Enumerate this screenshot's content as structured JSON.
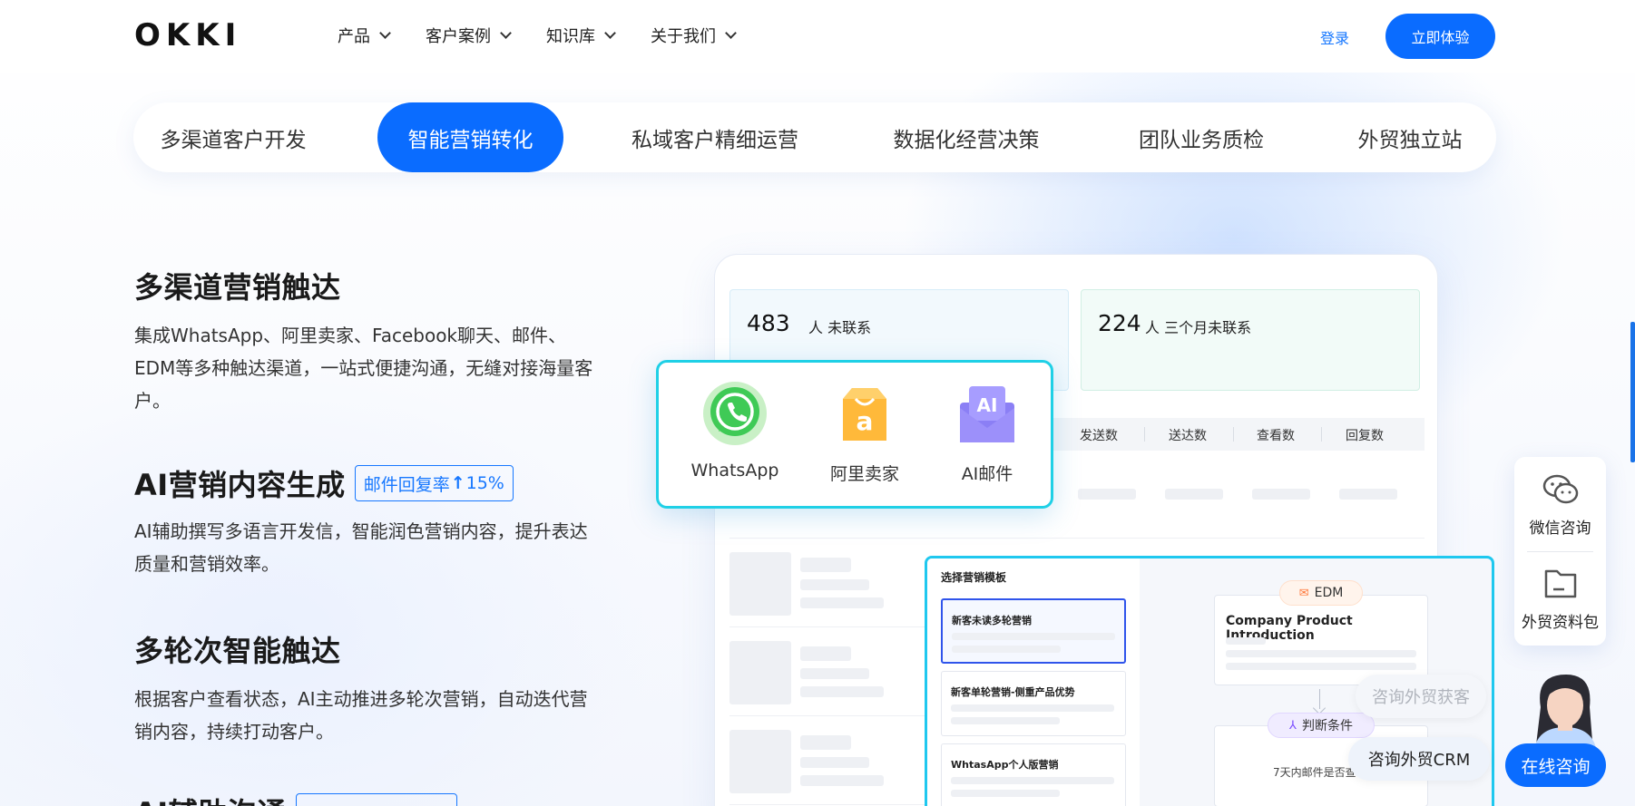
{
  "header": {
    "logo_text": "OKKI",
    "nav": [
      "产品",
      "客户案例",
      "知识库",
      "关于我们"
    ],
    "login": "登录",
    "cta": "立即体验"
  },
  "tabs": [
    {
      "label": "多渠道客户开发",
      "active": false
    },
    {
      "label": "智能营销转化",
      "active": true
    },
    {
      "label": "私域客户精细运营",
      "active": false
    },
    {
      "label": "数据化经营决策",
      "active": false
    },
    {
      "label": "团队业务质检",
      "active": false
    },
    {
      "label": "外贸独立站",
      "active": false
    }
  ],
  "features": [
    {
      "title": "多渠道营销触达",
      "desc": "集成WhatsApp、阿里卖家、Facebook聊天、邮件、EDM等多种触达渠道，一站式便捷沟通，无缝对接海量客户。"
    },
    {
      "title": "AI营销内容生成",
      "badge_text": "邮件回复率",
      "badge_value": "15%",
      "desc": "AI辅助撰写多语言开发信，智能润色营销内容，提升表达质量和营销效率。"
    },
    {
      "title": "多轮次智能触达",
      "desc": "根据客户查看状态，AI主动推进多轮次营销，自动迭代营销内容，持续打动客户。"
    },
    {
      "title": "AI辅助沟通"
    }
  ],
  "panel": {
    "stat1": {
      "num": "483",
      "label": "人 未联系"
    },
    "stat2": {
      "num": "224",
      "label": "人 三个月未联系"
    },
    "columns": [
      "发送数",
      "送达数",
      "查看数",
      "回复数"
    ]
  },
  "channels": [
    {
      "name": "WhatsApp",
      "icon": "whatsapp-icon"
    },
    {
      "name": "阿里卖家",
      "icon": "alibaba-icon"
    },
    {
      "name": "AI邮件",
      "icon": "ai-mail-icon"
    }
  ],
  "template": {
    "title": "选择营销模板",
    "items": [
      "新客未读多轮营销",
      "新客单轮营销-侧重产品优势",
      "WhtasApp个人版营销"
    ],
    "edm_tag": "EDM",
    "edm_title": "Company Product Introduction",
    "condition_tag": "判断条件",
    "condition_text": "7天内邮件是否查看"
  },
  "float": {
    "wechat": "微信咨询",
    "pack": "外贸资料包",
    "bubble1": "咨询外贸获客",
    "bubble2": "咨询外贸CRM",
    "online": "在线咨询"
  },
  "colors": {
    "primary": "#0a6cff",
    "accent_cyan": "#1fd0e6"
  }
}
